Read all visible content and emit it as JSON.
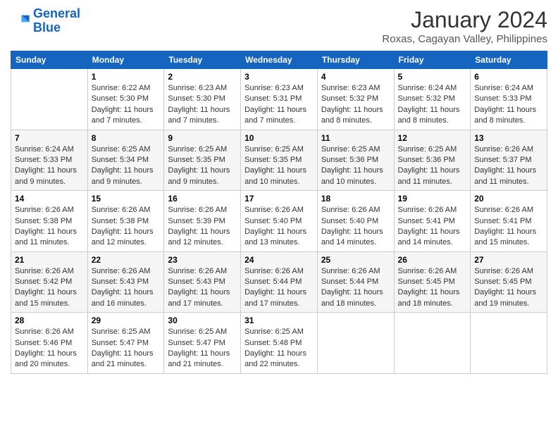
{
  "logo": {
    "line1": "General",
    "line2": "Blue"
  },
  "title": "January 2024",
  "subtitle": "Roxas, Cagayan Valley, Philippines",
  "header_days": [
    "Sunday",
    "Monday",
    "Tuesday",
    "Wednesday",
    "Thursday",
    "Friday",
    "Saturday"
  ],
  "weeks": [
    [
      {
        "num": "",
        "info": ""
      },
      {
        "num": "1",
        "info": "Sunrise: 6:22 AM\nSunset: 5:30 PM\nDaylight: 11 hours\nand 7 minutes."
      },
      {
        "num": "2",
        "info": "Sunrise: 6:23 AM\nSunset: 5:30 PM\nDaylight: 11 hours\nand 7 minutes."
      },
      {
        "num": "3",
        "info": "Sunrise: 6:23 AM\nSunset: 5:31 PM\nDaylight: 11 hours\nand 7 minutes."
      },
      {
        "num": "4",
        "info": "Sunrise: 6:23 AM\nSunset: 5:32 PM\nDaylight: 11 hours\nand 8 minutes."
      },
      {
        "num": "5",
        "info": "Sunrise: 6:24 AM\nSunset: 5:32 PM\nDaylight: 11 hours\nand 8 minutes."
      },
      {
        "num": "6",
        "info": "Sunrise: 6:24 AM\nSunset: 5:33 PM\nDaylight: 11 hours\nand 8 minutes."
      }
    ],
    [
      {
        "num": "7",
        "info": "Sunrise: 6:24 AM\nSunset: 5:33 PM\nDaylight: 11 hours\nand 9 minutes."
      },
      {
        "num": "8",
        "info": "Sunrise: 6:25 AM\nSunset: 5:34 PM\nDaylight: 11 hours\nand 9 minutes."
      },
      {
        "num": "9",
        "info": "Sunrise: 6:25 AM\nSunset: 5:35 PM\nDaylight: 11 hours\nand 9 minutes."
      },
      {
        "num": "10",
        "info": "Sunrise: 6:25 AM\nSunset: 5:35 PM\nDaylight: 11 hours\nand 10 minutes."
      },
      {
        "num": "11",
        "info": "Sunrise: 6:25 AM\nSunset: 5:36 PM\nDaylight: 11 hours\nand 10 minutes."
      },
      {
        "num": "12",
        "info": "Sunrise: 6:25 AM\nSunset: 5:36 PM\nDaylight: 11 hours\nand 11 minutes."
      },
      {
        "num": "13",
        "info": "Sunrise: 6:26 AM\nSunset: 5:37 PM\nDaylight: 11 hours\nand 11 minutes."
      }
    ],
    [
      {
        "num": "14",
        "info": "Sunrise: 6:26 AM\nSunset: 5:38 PM\nDaylight: 11 hours\nand 11 minutes."
      },
      {
        "num": "15",
        "info": "Sunrise: 6:26 AM\nSunset: 5:38 PM\nDaylight: 11 hours\nand 12 minutes."
      },
      {
        "num": "16",
        "info": "Sunrise: 6:26 AM\nSunset: 5:39 PM\nDaylight: 11 hours\nand 12 minutes."
      },
      {
        "num": "17",
        "info": "Sunrise: 6:26 AM\nSunset: 5:40 PM\nDaylight: 11 hours\nand 13 minutes."
      },
      {
        "num": "18",
        "info": "Sunrise: 6:26 AM\nSunset: 5:40 PM\nDaylight: 11 hours\nand 14 minutes."
      },
      {
        "num": "19",
        "info": "Sunrise: 6:26 AM\nSunset: 5:41 PM\nDaylight: 11 hours\nand 14 minutes."
      },
      {
        "num": "20",
        "info": "Sunrise: 6:26 AM\nSunset: 5:41 PM\nDaylight: 11 hours\nand 15 minutes."
      }
    ],
    [
      {
        "num": "21",
        "info": "Sunrise: 6:26 AM\nSunset: 5:42 PM\nDaylight: 11 hours\nand 15 minutes."
      },
      {
        "num": "22",
        "info": "Sunrise: 6:26 AM\nSunset: 5:43 PM\nDaylight: 11 hours\nand 16 minutes."
      },
      {
        "num": "23",
        "info": "Sunrise: 6:26 AM\nSunset: 5:43 PM\nDaylight: 11 hours\nand 17 minutes."
      },
      {
        "num": "24",
        "info": "Sunrise: 6:26 AM\nSunset: 5:44 PM\nDaylight: 11 hours\nand 17 minutes."
      },
      {
        "num": "25",
        "info": "Sunrise: 6:26 AM\nSunset: 5:44 PM\nDaylight: 11 hours\nand 18 minutes."
      },
      {
        "num": "26",
        "info": "Sunrise: 6:26 AM\nSunset: 5:45 PM\nDaylight: 11 hours\nand 18 minutes."
      },
      {
        "num": "27",
        "info": "Sunrise: 6:26 AM\nSunset: 5:45 PM\nDaylight: 11 hours\nand 19 minutes."
      }
    ],
    [
      {
        "num": "28",
        "info": "Sunrise: 6:26 AM\nSunset: 5:46 PM\nDaylight: 11 hours\nand 20 minutes."
      },
      {
        "num": "29",
        "info": "Sunrise: 6:25 AM\nSunset: 5:47 PM\nDaylight: 11 hours\nand 21 minutes."
      },
      {
        "num": "30",
        "info": "Sunrise: 6:25 AM\nSunset: 5:47 PM\nDaylight: 11 hours\nand 21 minutes."
      },
      {
        "num": "31",
        "info": "Sunrise: 6:25 AM\nSunset: 5:48 PM\nDaylight: 11 hours\nand 22 minutes."
      },
      {
        "num": "",
        "info": ""
      },
      {
        "num": "",
        "info": ""
      },
      {
        "num": "",
        "info": ""
      }
    ]
  ]
}
